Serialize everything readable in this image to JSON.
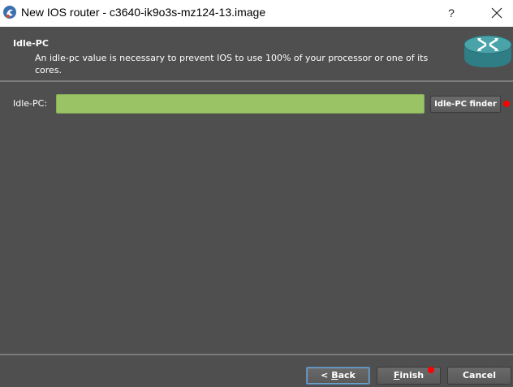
{
  "window": {
    "title": "New IOS router - c3640-ik9o3s-mz124-13.image",
    "help_label": "?",
    "app_icon": "gns3-icon",
    "close_icon": "close-icon"
  },
  "header": {
    "title": "Idle-PC",
    "subtitle": "An idle-pc value is necessary to prevent IOS to use 100% of your processor or one of its cores.",
    "logo_icon": "router-icon"
  },
  "form": {
    "idle_pc_label": "Idle-PC:",
    "idle_pc_value": "",
    "finder_button_label": "Idle-PC finder"
  },
  "footer": {
    "back_mnemonic": "B",
    "back_rest": "ack",
    "back_prefix": "< ",
    "finish_mnemonic": "F",
    "finish_rest": "inish",
    "cancel_label": "Cancel"
  },
  "colors": {
    "background": "#4f4f4f",
    "input_fill": "#9ac366",
    "marker": "#ff0000",
    "focus_border": "#5a8ab8"
  }
}
